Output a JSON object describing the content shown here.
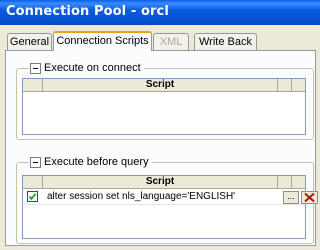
{
  "window": {
    "title": "Connection Pool - orcl"
  },
  "tabs": [
    {
      "label": "General"
    },
    {
      "label": "Connection Scripts"
    },
    {
      "label": "XML"
    },
    {
      "label": "Write Back"
    }
  ],
  "execute_on_connect": {
    "label": "Execute on connect",
    "column_header": "Script",
    "rows": []
  },
  "execute_before_query": {
    "label": "Execute before query",
    "column_header": "Script",
    "rows": [
      {
        "checked": true,
        "script": "alter session set nls_language='ENGLISH'",
        "ellipsis": "..."
      }
    ]
  },
  "icons": {
    "delete": "delete-x-icon",
    "expander": "collapse-minus-icon",
    "checkbox": "checkmark-icon"
  },
  "colors": {
    "title_bar": "#0a5be0",
    "active_tab_accent": "#e3a21a",
    "delete_icon": "#b4160e"
  }
}
